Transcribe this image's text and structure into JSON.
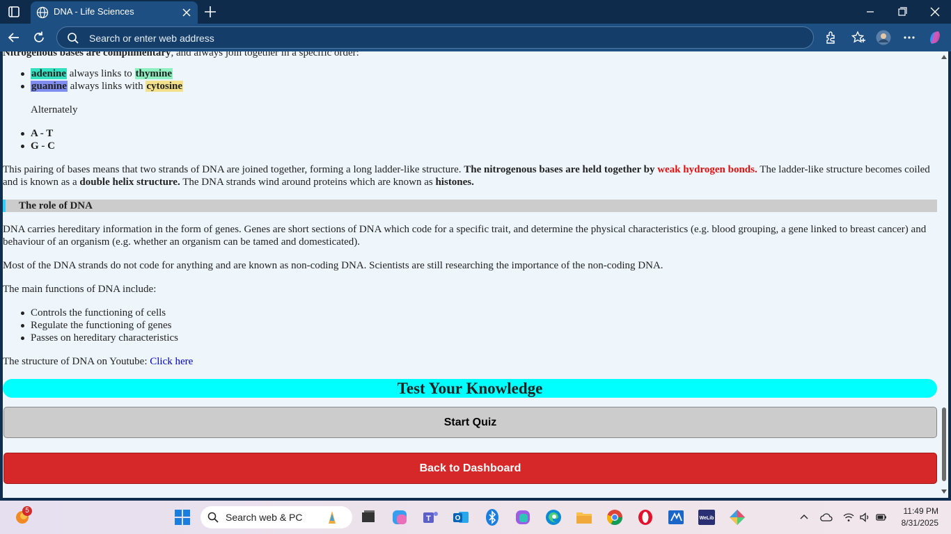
{
  "browser": {
    "tab_title": "DNA - Life Sciences",
    "address_placeholder": "Search or enter web address"
  },
  "page": {
    "cut_off_line_bold": "Nitrogenous bases are complimentary",
    "cut_off_line_rest": ", and always join together in a specific order:",
    "pairs": [
      {
        "first": "adenine",
        "first_color": "#33e0c0",
        "link": "always links to",
        "second": "thymine",
        "second_color": "#8ef0c0"
      },
      {
        "first": "guanine",
        "first_color": "#7f8cf0",
        "link": "always links with",
        "second": "cytosine",
        "second_color": "#f2e08a"
      }
    ],
    "alternately": "Alternately",
    "short_pairs": [
      "A - T",
      "G - C"
    ],
    "pairing_paragraph": {
      "p1": "This pairing of bases means that two strands of DNA are joined together, forming a long ladder-like structure.",
      "p2_bold": "The nitrogenous bases are held together by",
      "p3_red": "weak hydrogen bonds.",
      "p4": "The ladder-like structure becomes coiled and is known as a",
      "p5_bold": "double helix structure.",
      "p6": "The DNA strands wind around proteins which are known as",
      "p7_bold": "histones."
    },
    "role_heading": "The role of DNA",
    "role_paragraph": "DNA carries hereditary information in the form of genes. Genes are short sections of DNA which code for a specific trait, and determine the physical characteristics (e.g. blood grouping, a gene linked to breast cancer) and behaviour of an organism (e.g. whether an organism can be tamed and domesticated).",
    "noncoding_paragraph": "Most of the DNA strands do not code for anything and are known as non-coding DNA. Scientists are still researching the importance of the non-coding DNA.",
    "functions_intro": "The main functions of DNA include:",
    "functions": [
      "Controls the functioning of cells",
      "Regulate the functioning of genes",
      "Passes on hereditary characteristics"
    ],
    "youtube_text": "The structure of DNA on Youtube:",
    "youtube_link": "Click here",
    "quiz_heading": "Test Your Knowledge",
    "start_quiz": "Start Quiz",
    "back_button": "Back to Dashboard"
  },
  "taskbar": {
    "search_text": "Search web & PC",
    "widget_badge": "5",
    "time": "11:49 PM",
    "date": "8/31/2025"
  },
  "colors": {
    "quiz_banner": "#00ffff",
    "back_button": "#d62828",
    "role_bar": "#cccccc",
    "role_accent": "#33ccff",
    "red_text": "#e01010"
  }
}
